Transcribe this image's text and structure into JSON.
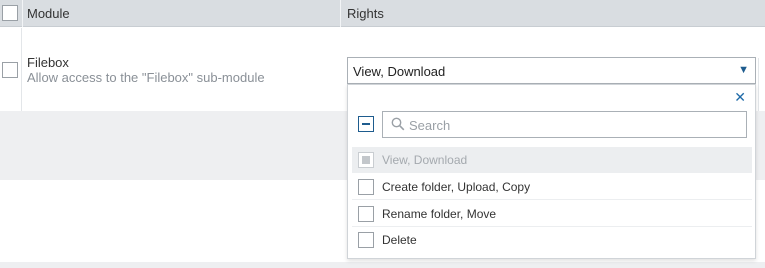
{
  "table": {
    "headers": {
      "module": "Module",
      "rights": "Rights"
    },
    "row": {
      "name": "Filebox",
      "description": "Allow access to the \"Filebox\" sub-module",
      "selected_rights": "View, Download"
    }
  },
  "dropdown": {
    "search_placeholder": "Search",
    "close_icon": "close-icon",
    "options": [
      {
        "label": "View, Download",
        "state": "disabled-checked"
      },
      {
        "label": "Create folder, Upload, Copy",
        "state": "unchecked"
      },
      {
        "label": "Rename folder, Move",
        "state": "unchecked"
      },
      {
        "label": "Delete",
        "state": "unchecked"
      }
    ]
  },
  "colors": {
    "accent": "#1e5c8e",
    "header_bg": "#d9dde1",
    "band_bg": "#eeeff1"
  }
}
